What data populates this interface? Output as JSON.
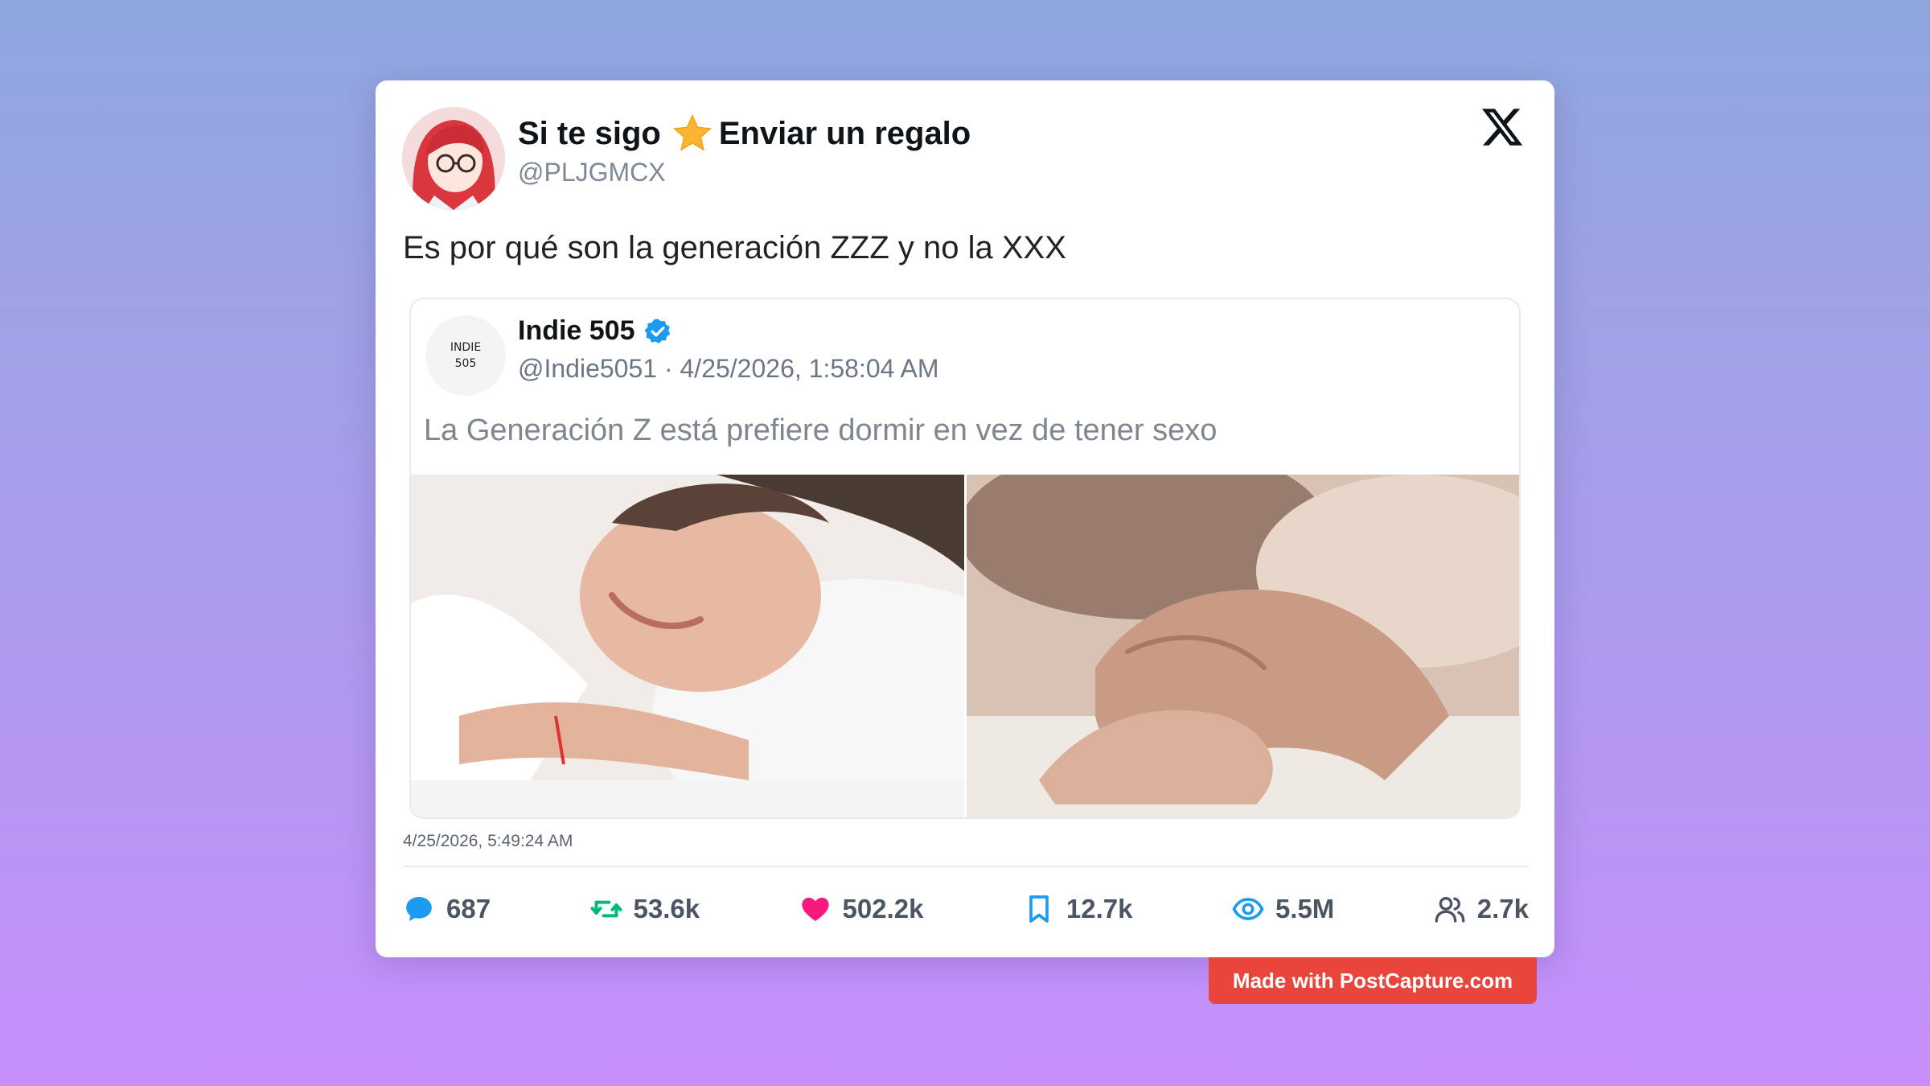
{
  "author": {
    "name_part1": "Si te sigo",
    "name_part2": "Enviar un regalo",
    "handle": "@PLJGMCX"
  },
  "tweet_text": "Es por qué son la generación ZZZ y no la XXX",
  "quoted": {
    "avatar_line1": "INDIE",
    "avatar_line2": "505",
    "name": "Indie 505",
    "handle": "@Indie5051",
    "separator": "·",
    "date": "4/25/2026, 1:58:04 AM",
    "text": "La Generación Z está prefiere dormir en vez de tener sexo"
  },
  "timestamp": "4/25/2026, 5:49:24 AM",
  "stats": {
    "replies": "687",
    "retweets": "53.6k",
    "likes": "502.2k",
    "bookmarks": "12.7k",
    "views": "5.5M",
    "followers": "2.7k"
  },
  "watermark": "Made with PostCapture.com",
  "colors": {
    "reply": "#1d9bf0",
    "retweet": "#00ba7c",
    "like": "#f91880",
    "bookmark": "#1d9bf0",
    "views": "#1d9bf0",
    "followers": "#4b5563",
    "watermark_bg": "#e8453c"
  },
  "icons": [
    "x-logo-icon",
    "star-icon",
    "verified-badge-icon",
    "reply-icon",
    "retweet-icon",
    "like-icon",
    "bookmark-icon",
    "views-icon",
    "followers-icon"
  ]
}
